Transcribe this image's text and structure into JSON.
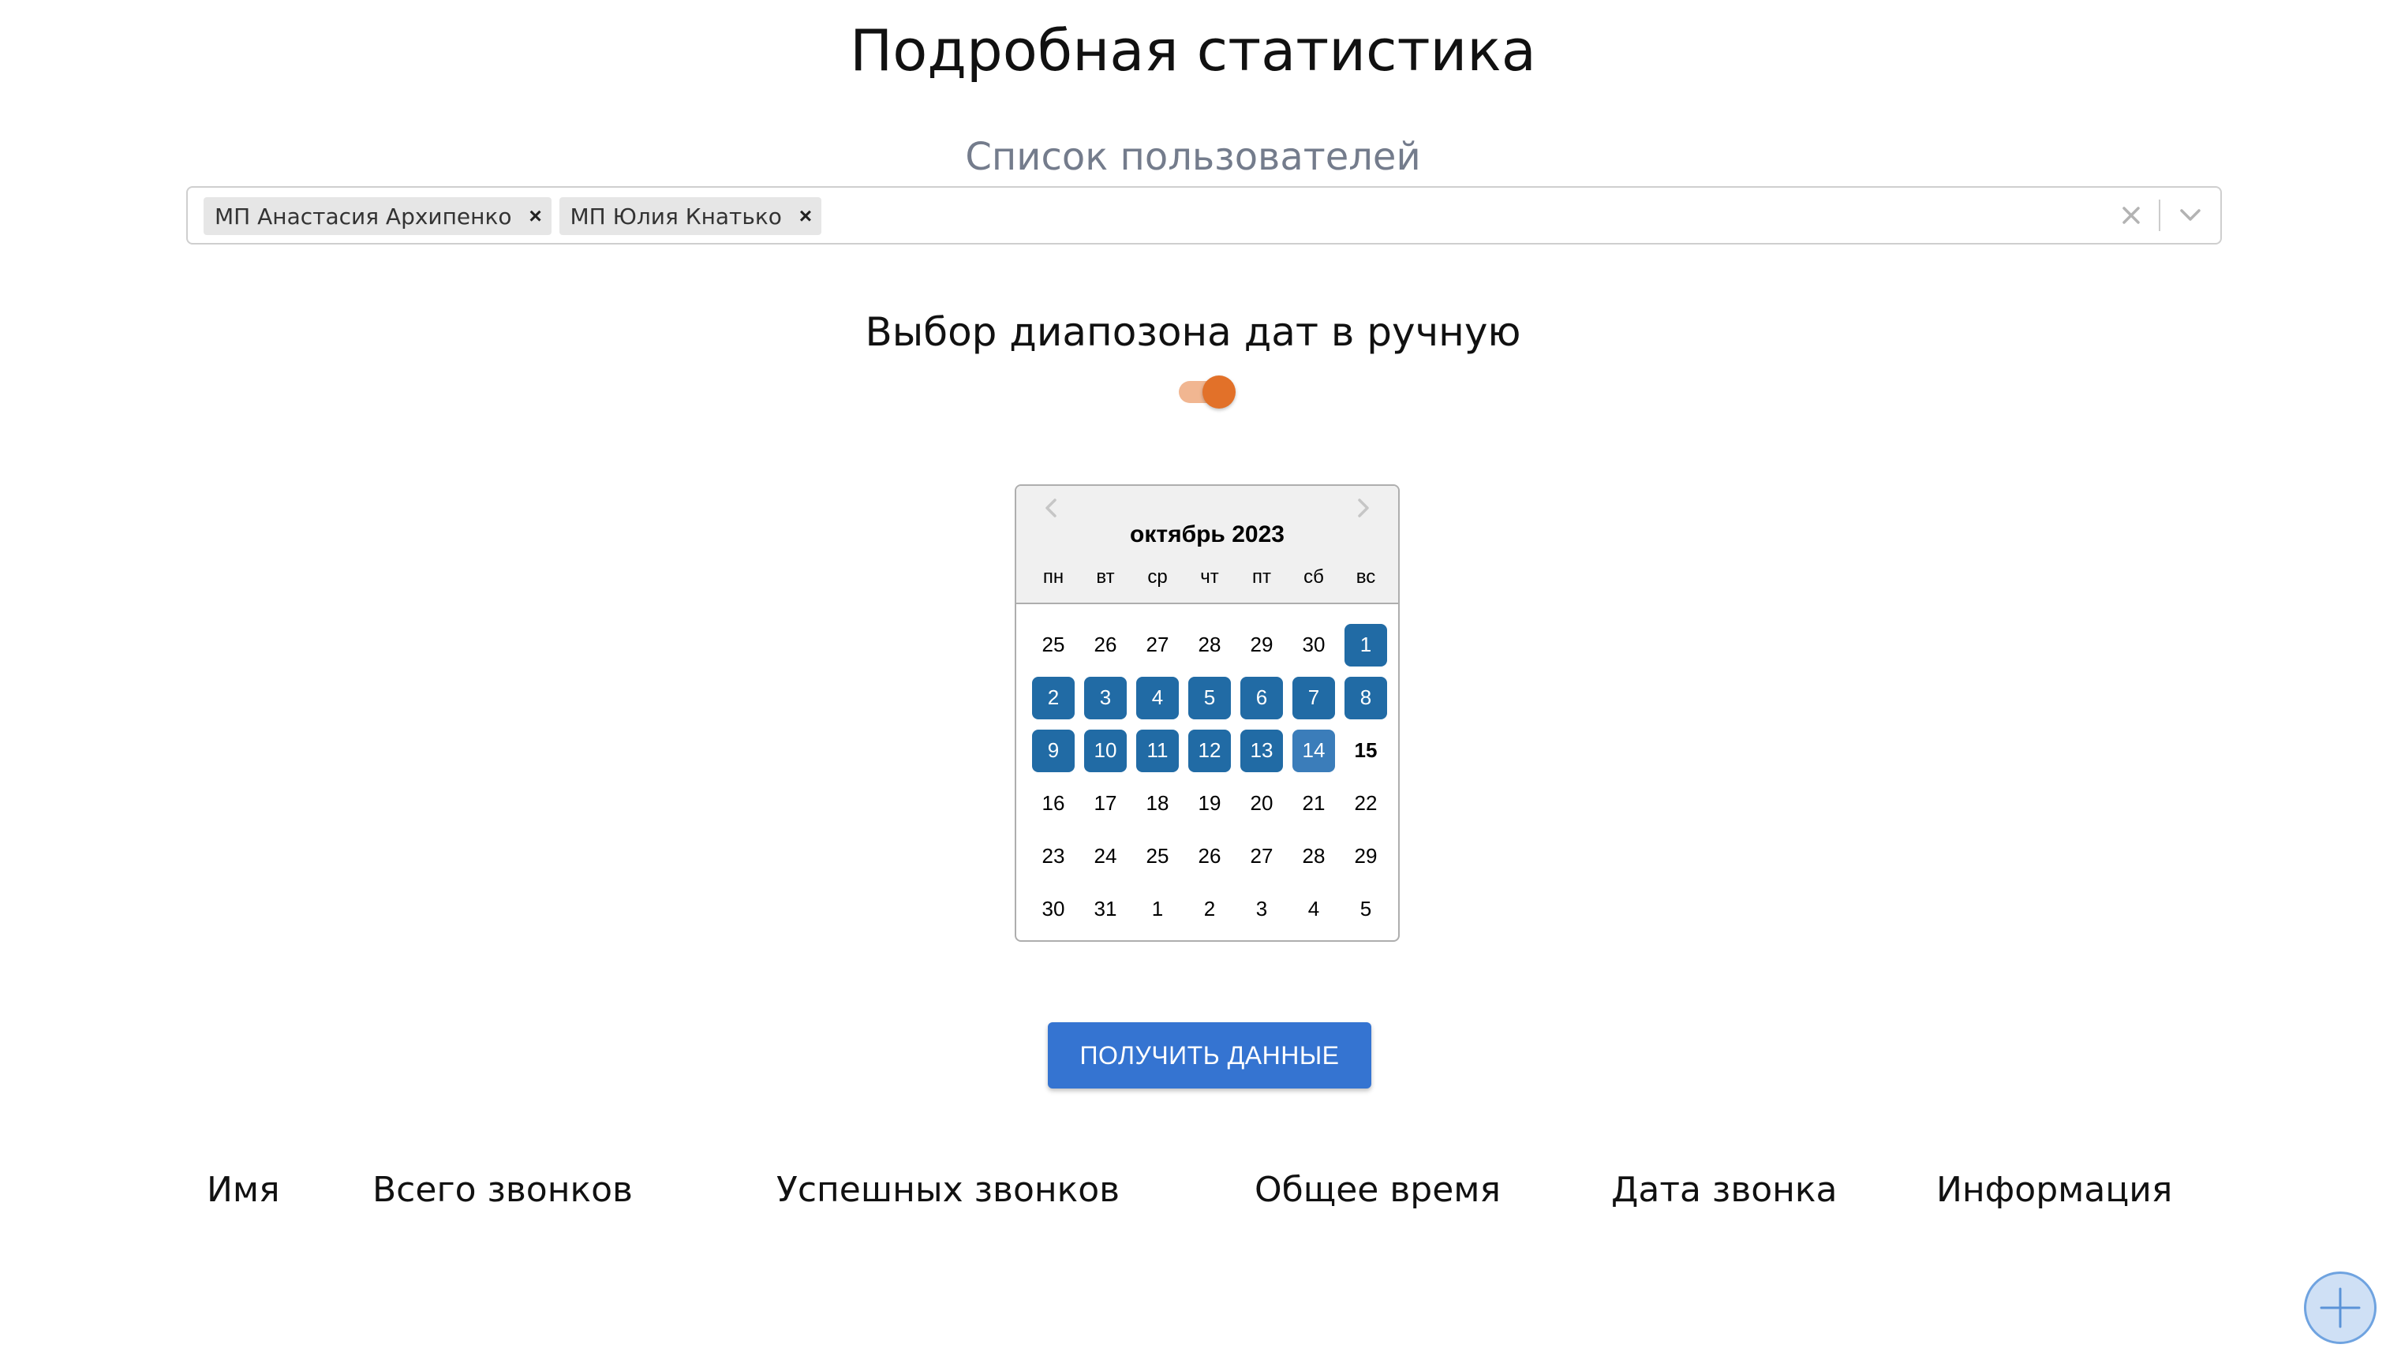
{
  "page": {
    "title": "Подробная статистика"
  },
  "users": {
    "label": "Список пользователей",
    "selected": [
      {
        "label": "МП Анастасия Архипенко",
        "remove": "×"
      },
      {
        "label": "МП Юлия Кнатько",
        "remove": "×"
      }
    ]
  },
  "date_range": {
    "label": "Выбор диапозона дат в ручную",
    "manual_enabled": true
  },
  "calendar": {
    "month": "октябрь 2023",
    "weekdays": [
      "пн",
      "вт",
      "ср",
      "чт",
      "пт",
      "сб",
      "вс"
    ],
    "weeks": [
      [
        "25",
        "26",
        "27",
        "28",
        "29",
        "30",
        "1"
      ],
      [
        "2",
        "3",
        "4",
        "5",
        "6",
        "7",
        "8"
      ],
      [
        "9",
        "10",
        "11",
        "12",
        "13",
        "14",
        "15"
      ],
      [
        "16",
        "17",
        "18",
        "19",
        "20",
        "21",
        "22"
      ],
      [
        "23",
        "24",
        "25",
        "26",
        "27",
        "28",
        "29"
      ],
      [
        "30",
        "31",
        "1",
        "2",
        "3",
        "4",
        "5"
      ]
    ],
    "selected_start": "1",
    "selected_end": "14",
    "today": "15"
  },
  "actions": {
    "fetch_label": "ПОЛУЧИТЬ ДАННЫЕ"
  },
  "table": {
    "columns": [
      "Имя",
      "Всего звонков",
      "Успешных звонков",
      "Общее время",
      "Дата звонка",
      "Информация"
    ]
  },
  "colors": {
    "accent_orange": "#e27129",
    "selected_day": "#216ba5",
    "button_blue": "#3574d1"
  }
}
